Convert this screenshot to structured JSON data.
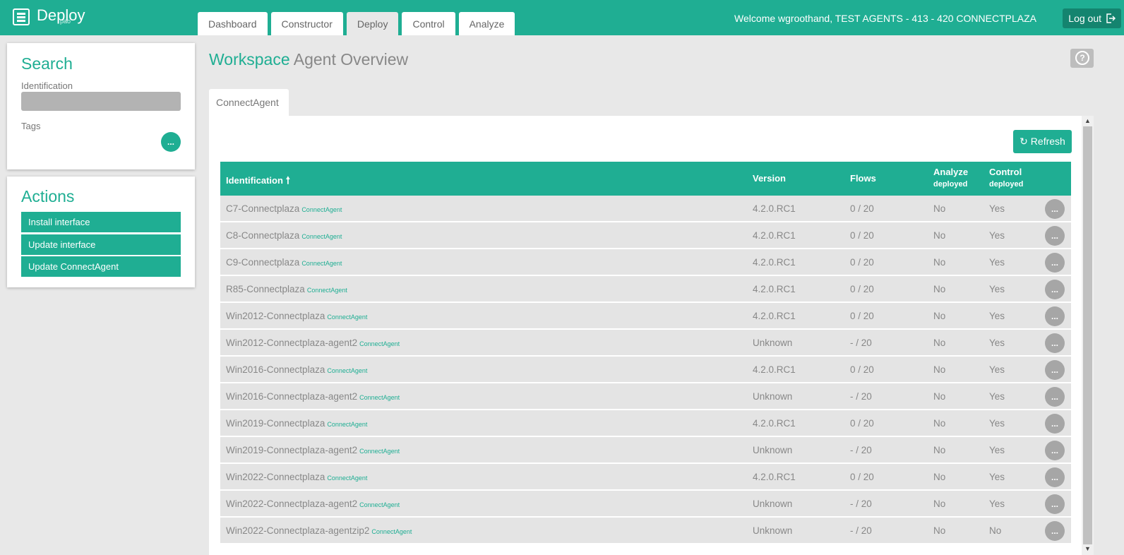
{
  "app": {
    "name": "Deploy",
    "subtitle": "pao"
  },
  "nav": {
    "tabs": [
      "Dashboard",
      "Constructor",
      "Deploy",
      "Control",
      "Analyze"
    ],
    "active": "Deploy"
  },
  "header": {
    "welcome": "Welcome wgroothand, TEST AGENTS - 413 - 420 CONNECTPLAZA",
    "logout_label": "Log out"
  },
  "search": {
    "title": "Search",
    "identification_label": "Identification",
    "identification_value": "",
    "tags_label": "Tags",
    "tags_button": "..."
  },
  "actions": {
    "title": "Actions",
    "items": [
      "Install interface",
      "Update interface",
      "Update ConnectAgent"
    ]
  },
  "page": {
    "title_accent": "Workspace",
    "title_rest": "Agent Overview",
    "help": "?"
  },
  "subtab": "ConnectAgent",
  "refresh_label": "Refresh",
  "table": {
    "headers": {
      "identification": "Identification",
      "version": "Version",
      "flows": "Flows",
      "analyze": "Analyze",
      "analyze_sub": "deployed",
      "control": "Control",
      "control_sub": "deployed"
    },
    "row_button": "...",
    "rows": [
      {
        "name": "C7-Connectplaza",
        "tag": "ConnectAgent",
        "version": "4.2.0.RC1",
        "flows": "0 / 20",
        "analyze": "No",
        "control": "Yes"
      },
      {
        "name": "C8-Connectplaza",
        "tag": "ConnectAgent",
        "version": "4.2.0.RC1",
        "flows": "0 / 20",
        "analyze": "No",
        "control": "Yes"
      },
      {
        "name": "C9-Connectplaza",
        "tag": "ConnectAgent",
        "version": "4.2.0.RC1",
        "flows": "0 / 20",
        "analyze": "No",
        "control": "Yes"
      },
      {
        "name": "R85-Connectplaza",
        "tag": "ConnectAgent",
        "version": "4.2.0.RC1",
        "flows": "0 / 20",
        "analyze": "No",
        "control": "Yes"
      },
      {
        "name": "Win2012-Connectplaza",
        "tag": "ConnectAgent",
        "version": "4.2.0.RC1",
        "flows": "0 / 20",
        "analyze": "No",
        "control": "Yes"
      },
      {
        "name": "Win2012-Connectplaza-agent2",
        "tag": "ConnectAgent",
        "version": "Unknown",
        "flows": "- / 20",
        "analyze": "No",
        "control": "Yes"
      },
      {
        "name": "Win2016-Connectplaza",
        "tag": "ConnectAgent",
        "version": "4.2.0.RC1",
        "flows": "0 / 20",
        "analyze": "No",
        "control": "Yes"
      },
      {
        "name": "Win2016-Connectplaza-agent2",
        "tag": "ConnectAgent",
        "version": "Unknown",
        "flows": "- / 20",
        "analyze": "No",
        "control": "Yes"
      },
      {
        "name": "Win2019-Connectplaza",
        "tag": "ConnectAgent",
        "version": "4.2.0.RC1",
        "flows": "0 / 20",
        "analyze": "No",
        "control": "Yes"
      },
      {
        "name": "Win2019-Connectplaza-agent2",
        "tag": "ConnectAgent",
        "version": "Unknown",
        "flows": "- / 20",
        "analyze": "No",
        "control": "Yes"
      },
      {
        "name": "Win2022-Connectplaza",
        "tag": "ConnectAgent",
        "version": "4.2.0.RC1",
        "flows": "0 / 20",
        "analyze": "No",
        "control": "Yes"
      },
      {
        "name": "Win2022-Connectplaza-agent2",
        "tag": "ConnectAgent",
        "version": "Unknown",
        "flows": "- / 20",
        "analyze": "No",
        "control": "Yes"
      },
      {
        "name": "Win2022-Connectplaza-agentzip2",
        "tag": "ConnectAgent",
        "version": "Unknown",
        "flows": "- / 20",
        "analyze": "No",
        "control": "No"
      }
    ]
  },
  "colors": {
    "accent": "#1fae93",
    "accent_dark": "#14846f",
    "row_bg": "#e4e4e4",
    "button_grey": "#a6a6a6"
  },
  "icons": {
    "logo": "menu-list-icon",
    "logout": "logout-icon",
    "sort": "arrow-up-icon",
    "refresh": "refresh-icon",
    "help": "question-icon"
  }
}
